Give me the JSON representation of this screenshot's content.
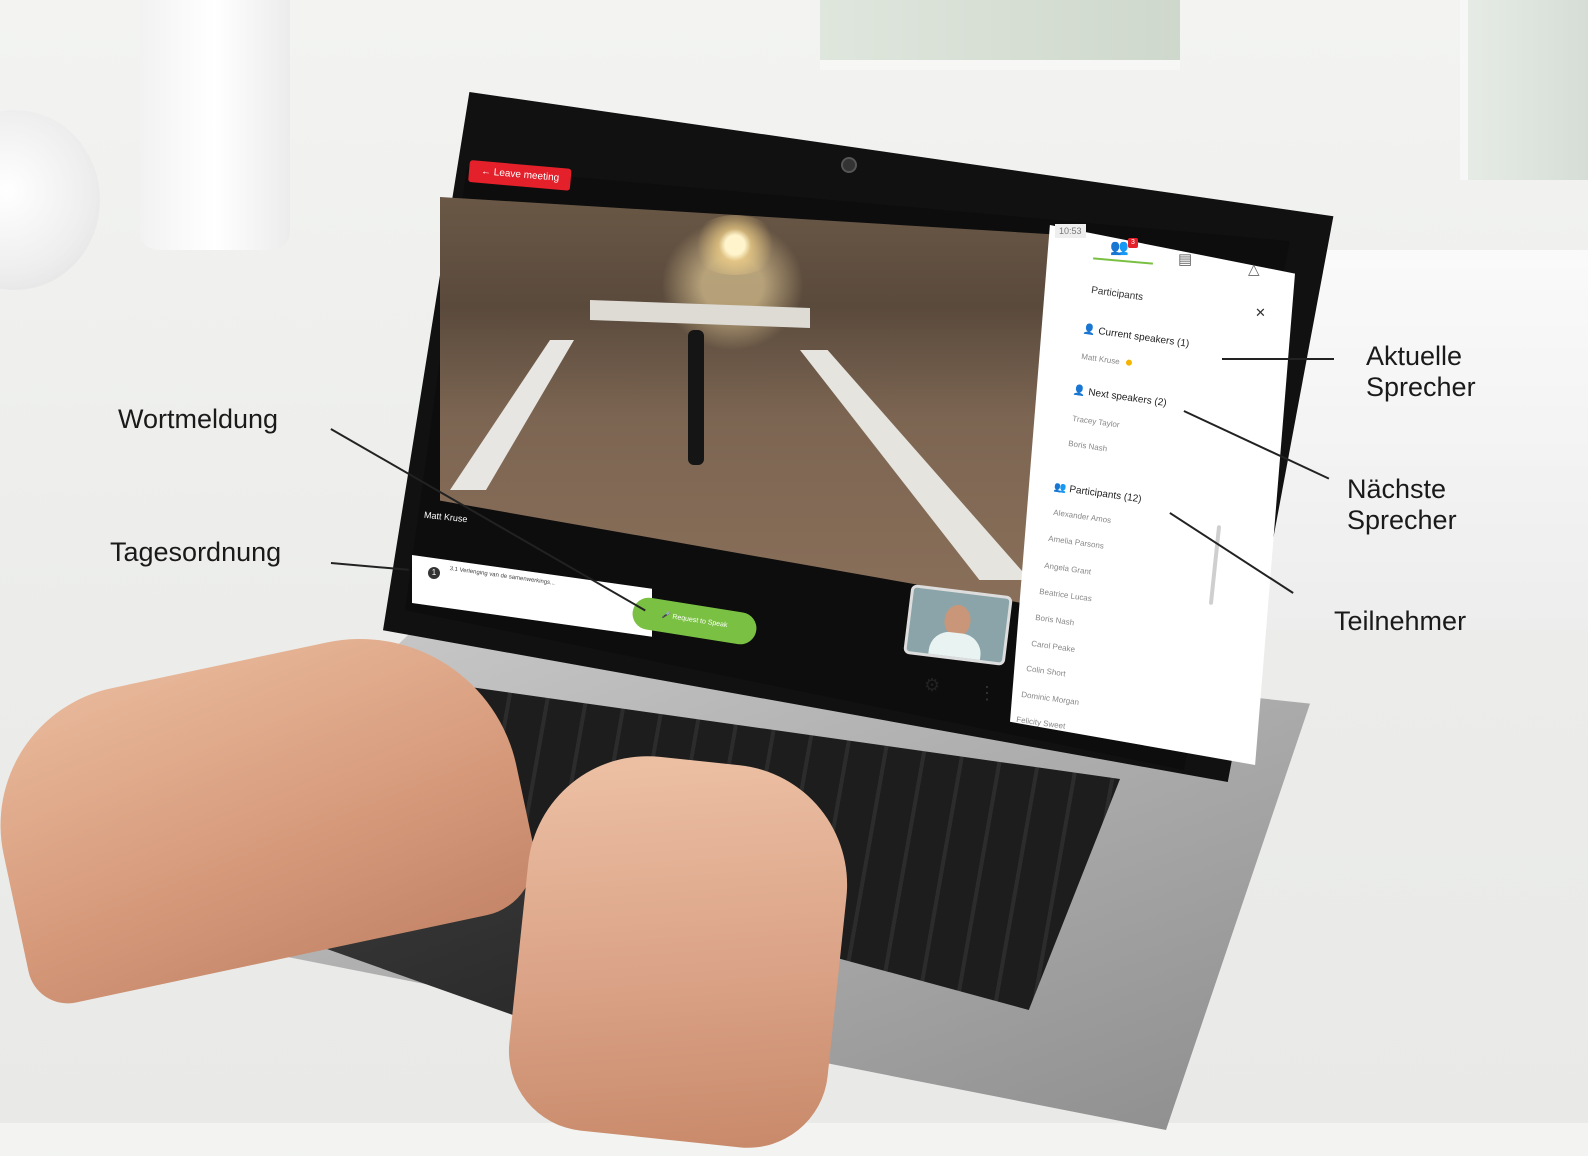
{
  "meeting": {
    "leave_label": "Leave meeting",
    "speaker_name": "Matt Kruse",
    "agenda_number": "1",
    "agenda_item": "3.1 Verlenging van de samenwerkings...",
    "request_label": "Request to Speak"
  },
  "panel": {
    "time": "10:53",
    "participants_badge": "3",
    "title": "Participants",
    "current_speakers_header": "Current speakers (1)",
    "current_speakers": [
      "Matt Kruse"
    ],
    "next_speakers_header": "Next speakers (2)",
    "next_speakers": [
      "Tracey Taylor",
      "Boris Nash"
    ],
    "participants_header": "Participants (12)",
    "participants": [
      "Alexander Amos",
      "Amelia Parsons",
      "Angela Grant",
      "Beatrice Lucas",
      "Boris Nash",
      "Carol Peake",
      "Colin Short",
      "Dominic Morgan",
      "Felicity Sweet"
    ]
  },
  "annotations": {
    "aktuelle": "Aktuelle\nSprecher",
    "naechste": "Nächste\nSprecher",
    "teilnehmer": "Teilnehmer",
    "wortmeldung": "Wortmeldung",
    "tagesordnung": "Tagesordnung"
  },
  "icons": {
    "leave": "arrow-left-icon",
    "agenda": "info-icon",
    "request": "microphone-icon",
    "settings": "gear-icon",
    "more": "more-vertical-icon",
    "participants_tab": "people-icon",
    "chat_tab": "chat-icon",
    "notifications_tab": "bell-icon",
    "close": "close-icon"
  },
  "colors": {
    "accent_red": "#e4202a",
    "accent_green": "#7ac143",
    "speaking_indicator": "#f4b400"
  }
}
